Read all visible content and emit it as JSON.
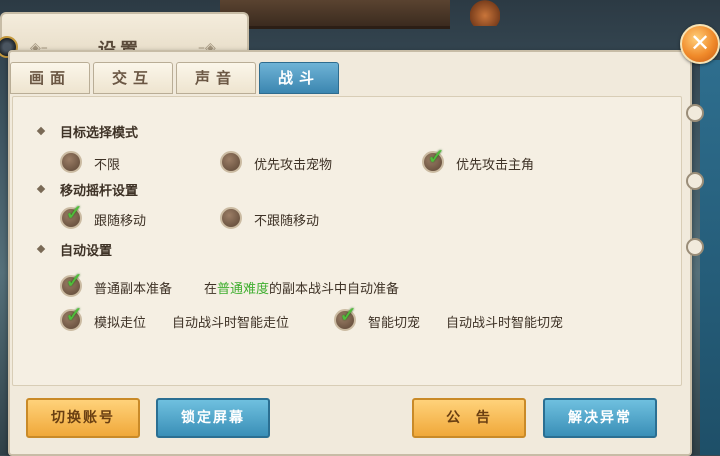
{
  "header": {
    "title": "设置",
    "close_icon": "close-icon"
  },
  "tabs": [
    {
      "label": "画面",
      "active": false
    },
    {
      "label": "交互",
      "active": false
    },
    {
      "label": "声音",
      "active": false
    },
    {
      "label": "战斗",
      "active": true
    }
  ],
  "sections": {
    "target": {
      "title": "目标选择模式",
      "options": [
        {
          "label": "不限",
          "checked": false
        },
        {
          "label": "优先攻击宠物",
          "checked": false
        },
        {
          "label": "优先攻击主角",
          "checked": true
        }
      ]
    },
    "joystick": {
      "title": "移动摇杆设置",
      "options": [
        {
          "label": "跟随移动",
          "checked": true
        },
        {
          "label": "不跟随移动",
          "checked": false
        }
      ]
    },
    "auto": {
      "title": "自动设置",
      "items": [
        {
          "label": "普通副本准备",
          "checked": true,
          "desc_pre": "在",
          "desc_highlight": "普通难度",
          "desc_post": "的副本战斗中自动准备"
        },
        {
          "label": "模拟走位",
          "checked": true,
          "desc": "自动战斗时智能走位"
        },
        {
          "label": "智能切宠",
          "checked": true,
          "desc": "自动战斗时智能切宠"
        }
      ]
    }
  },
  "buttons": {
    "switch_account": "切换账号",
    "lock_screen": "锁定屏幕",
    "announcement": "公  告",
    "fix_issue": "解决异常"
  },
  "colors": {
    "accent_blue": "#3b86b0",
    "accent_yellow": "#f0a83a",
    "check_green": "#4fbf3a",
    "highlight_green": "#3fae2f"
  }
}
